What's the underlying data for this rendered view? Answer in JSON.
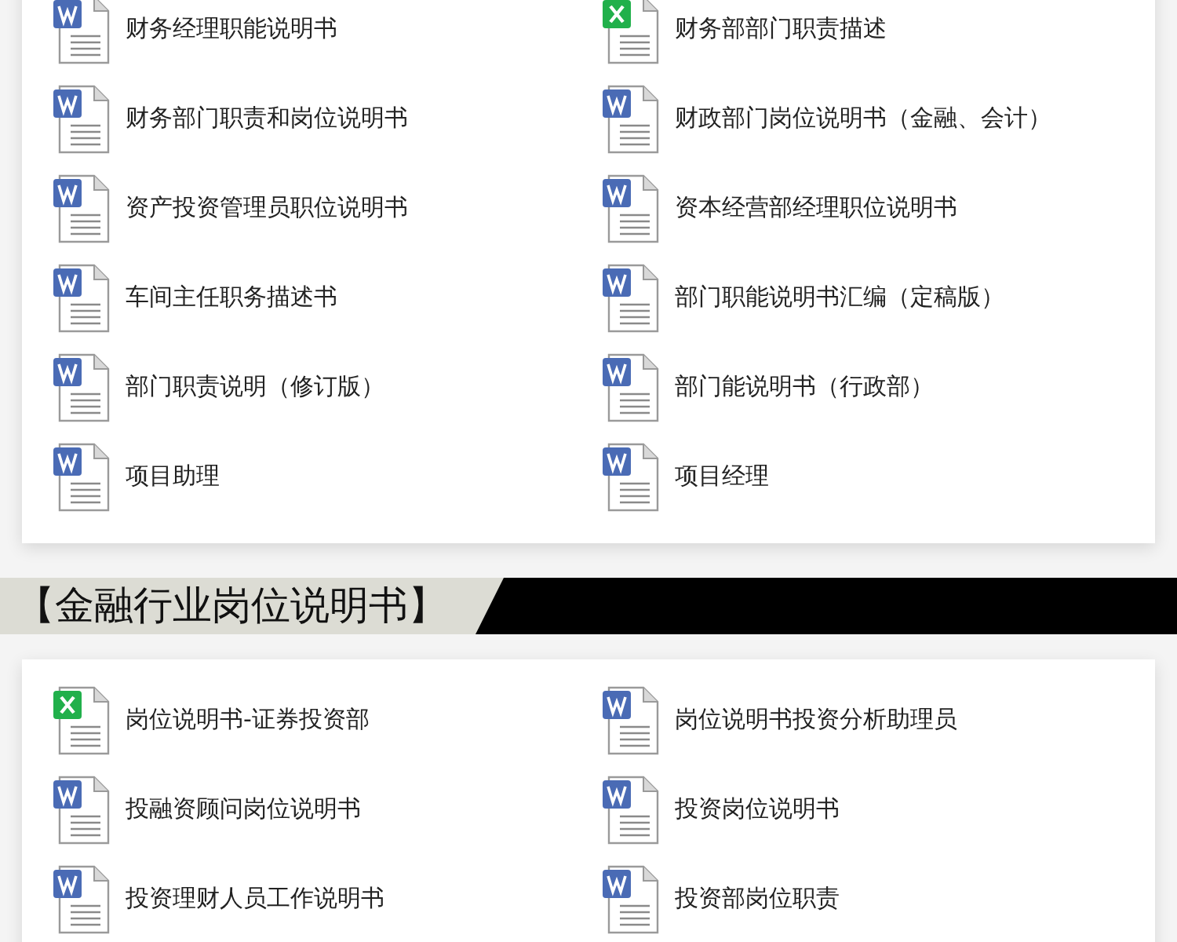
{
  "sections": [
    {
      "files": [
        {
          "name": "财务经理职能说明书",
          "kind": "word"
        },
        {
          "name": "财务部部门职责描述",
          "kind": "excel"
        },
        {
          "name": "财务部门职责和岗位说明书",
          "kind": "word"
        },
        {
          "name": "财政部门岗位说明书（金融、会计）",
          "kind": "word"
        },
        {
          "name": "资产投资管理员职位说明书",
          "kind": "word"
        },
        {
          "name": "资本经营部经理职位说明书",
          "kind": "word"
        },
        {
          "name": "车间主任职务描述书",
          "kind": "word"
        },
        {
          "name": "部门职能说明书汇编（定稿版）",
          "kind": "word"
        },
        {
          "name": "部门职责说明（修订版）",
          "kind": "word"
        },
        {
          "name": "部门能说明书（行政部）",
          "kind": "word"
        },
        {
          "name": "项目助理",
          "kind": "word"
        },
        {
          "name": "项目经理",
          "kind": "word"
        }
      ]
    },
    {
      "title": "【金融行业岗位说明书】",
      "files": [
        {
          "name": "岗位说明书-证券投资部",
          "kind": "excel"
        },
        {
          "name": "岗位说明书投资分析助理员",
          "kind": "word"
        },
        {
          "name": "投融资顾问岗位说明书",
          "kind": "word"
        },
        {
          "name": "投资岗位说明书",
          "kind": "word"
        },
        {
          "name": "投资理财人员工作说明书",
          "kind": "word"
        },
        {
          "name": "投资部岗位职责",
          "kind": "word"
        }
      ]
    }
  ]
}
